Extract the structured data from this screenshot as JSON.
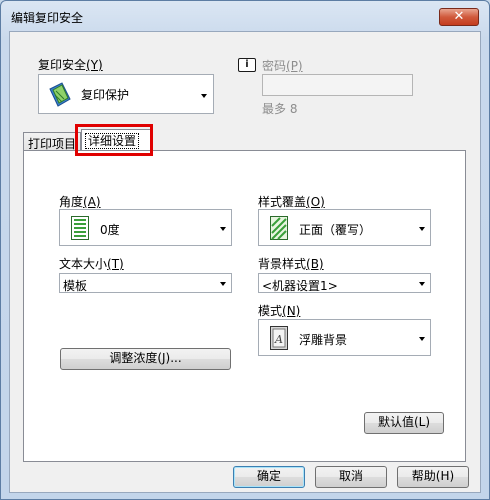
{
  "window": {
    "title": "编辑复印安全",
    "close_symbol": "✕"
  },
  "copy_security": {
    "label": "复印安全",
    "hotkey": "(Y)",
    "value": "复印保护",
    "icon": "copy-protect-icon"
  },
  "password": {
    "label": "密码",
    "hotkey": "(P)",
    "value": "",
    "hint": "最多 8",
    "info_icon_text": "i"
  },
  "tabs": [
    {
      "label": "打印项目"
    },
    {
      "label": "详细设置"
    }
  ],
  "detail": {
    "angle": {
      "label": "角度",
      "hotkey": "(A)",
      "value": "0度"
    },
    "pattern_overwrite": {
      "label": "样式覆盖",
      "hotkey": "(O)",
      "value": "正面（覆写）"
    },
    "text_size": {
      "label": "文本大小",
      "hotkey": "(T)",
      "value": "模板"
    },
    "background_pattern": {
      "label": "背景样式",
      "hotkey": "(B)",
      "value": "<机器设置1>"
    },
    "mode": {
      "label": "模式",
      "hotkey": "(N)",
      "value": "浮雕背景"
    },
    "adjust_density_button": "调整浓度(J)...",
    "default_button": "默认值(L)"
  },
  "footer": {
    "ok": "确定",
    "cancel": "取消",
    "help": "帮助(H)"
  }
}
